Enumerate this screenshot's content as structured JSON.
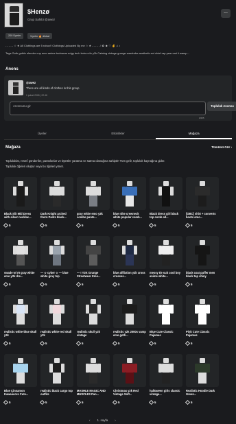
{
  "header": {
    "title": "$Henzø",
    "owner_label": "Grup Sahibi @awez",
    "more_label": "..."
  },
  "badges": [
    {
      "label": "200 Üyeler"
    },
    {
      "label": "Üyeler 🔥 dikkat"
    }
  ],
  "description": {
    "line1": "- - - - - ☆ ★ All Clothings are 5 robux!! Clothings Uploaded By me ☆ ★ - - - - - ! ✿ ☻ ♡ ✌ ♫ ♪",
    "line2": "Tags Goth gothic slender cnp emo anime tochwear edgy tech lmha e4x y2k Catalog vintage grunge wardrobe aesthetic ext chief rap year cari ii wamp..."
  },
  "shout": {
    "section_title": "Anons",
    "poster": "@awez",
    "message": "There are all kinds of clothes in this group",
    "date": "1 şubat 2026 | 22:46",
    "input_placeholder": "Anonsunu gir",
    "counter": "0/255",
    "post_button": "Topluluk Anonsu"
  },
  "tabs": [
    {
      "label": "Üyeler",
      "active": false
    },
    {
      "label": "Etkinlikler",
      "active": false
    },
    {
      "label": "Mağaza",
      "active": true
    }
  ],
  "store": {
    "title": "Mağaza",
    "see_all": "Tümünü Gör ›",
    "desc_line1": "Topluluklar, resmî gönderiler, pantolonlar ve tişörtler yaratma ve satma olanağına sahiptir! Tüm gelir, topluluk kaynağına gider.",
    "desc_line2": "Topluluk öğeleri oluştur veya bu öğeleri yönet."
  },
  "items": [
    {
      "name": "Black Slit Mid Dress with silver necklac...",
      "price": "5",
      "colors": {
        "torso": "#1a1a1a",
        "arms": "#dcdcdc",
        "legs": "#1a1a1a"
      }
    },
    {
      "name": "Dark Knight arched thorn Pants black...",
      "price": "5",
      "colors": {
        "torso": "#dcdcdc",
        "arms": "#dcdcdc",
        "legs": "#2a2a2a"
      }
    },
    {
      "name": "gray white emo y2k combo pants...",
      "price": "5",
      "colors": {
        "torso": "#dcdcdc",
        "arms": "#dcdcdc",
        "legs": "#7a7e85"
      }
    },
    {
      "name": "blue nike crewneck white popular comb...",
      "price": "5",
      "colors": {
        "torso": "#3a6fb8",
        "arms": "#3a6fb8",
        "legs": "#e8e8e8"
      }
    },
    {
      "name": "Black dress girl black top comb all...",
      "price": "5",
      "colors": {
        "torso": "#111111",
        "arms": "#dcdcdc",
        "legs": "#111111"
      }
    },
    {
      "name": "[OBC] shirt + converts boots emo...",
      "price": "5",
      "colors": {
        "torso": "#2b2b2b",
        "arms": "#2b2b2b",
        "legs": "#1c1c1c"
      }
    },
    {
      "name": "swade w/ r6 gray white emo y2k dre...",
      "price": "5",
      "colors": {
        "torso": "#e0e0e0",
        "arms": "#dcdcdc",
        "legs": "#555555"
      }
    },
    {
      "name": "— ☆ cyber ☆ — blue white gray top",
      "price": "5",
      "colors": {
        "torso": "#9aa3ad",
        "arms": "#dcdcdc",
        "legs": "#6e7680"
      }
    },
    {
      "name": "— ! Y2K Grunge Streetwear Emo...",
      "price": "5",
      "colors": {
        "torso": "#444444",
        "arms": "#444444",
        "legs": "#5c5c5c"
      }
    },
    {
      "name": "blue affliction y2k cross crosses...",
      "price": "5",
      "colors": {
        "torso": "#1f2a44",
        "arms": "#dcdcdc",
        "legs": "#2b3556"
      }
    },
    {
      "name": "messy tie suit cool boy anime white...",
      "price": "5",
      "colors": {
        "torso": "#eeeeee",
        "arms": "#eeeeee",
        "legs": "#222222"
      }
    },
    {
      "name": "black coat puffer men black top shiny",
      "price": "5",
      "colors": {
        "torso": "#151515",
        "arms": "#151515",
        "legs": "#151515"
      }
    },
    {
      "name": "realistic white-blue skull y2k",
      "price": "5",
      "colors": {
        "torso": "#d8e4f5",
        "arms": "#dcdcdc",
        "legs": "#dcdcdc"
      }
    },
    {
      "name": "realistic white-red skull y2k",
      "price": "5",
      "colors": {
        "torso": "#f0d8dc",
        "arms": "#dcdcdc",
        "legs": "#dcdcdc"
      }
    },
    {
      "name": "realistic skull y2k vintage",
      "price": "5",
      "colors": {
        "torso": "#2a2a2a",
        "arms": "#dcdcdc",
        "legs": "#dcdcdc"
      }
    },
    {
      "name": "realistic y2k 2000s vamp emo goth...",
      "price": "5",
      "colors": {
        "torso": "#1b1b1b",
        "arms": "#1b1b1b",
        "legs": "#dcdcdc"
      }
    },
    {
      "name": "Blue Cute Classic Pajamas",
      "price": "5",
      "colors": {
        "torso": "#ffffff",
        "arms": "#ffffff",
        "legs": "#ffffff"
      }
    },
    {
      "name": "Pink Cute Classic Pajamas",
      "price": "5",
      "colors": {
        "torso": "#ffffff",
        "arms": "#ffffff",
        "legs": "#ffffff"
      }
    },
    {
      "name": "Blue Cinnamon Kawaiicore Cute...",
      "price": "5",
      "colors": {
        "torso": "#a8d4ee",
        "arms": "#a8d4ee",
        "legs": "#dcdcdc"
      }
    },
    {
      "name": "realistic black cargo top outfits",
      "price": "5",
      "colors": {
        "torso": "#1e1e1e",
        "arms": "#dcdcdc",
        "legs": "#dcdcdc"
      }
    },
    {
      "name": "MASHLE MAGIC AND MUSCLES Pan...",
      "price": "5",
      "colors": {
        "torso": "#dcdcdc",
        "arms": "#dcdcdc",
        "legs": "#2a2a2a"
      }
    },
    {
      "name": "Christmas y2k Red Vintage Soft...",
      "price": "5",
      "colors": {
        "torso": "#8b1d24",
        "arms": "#8b1d24",
        "legs": "#5a1015"
      }
    },
    {
      "name": "halloween girls classic vintage...",
      "price": "5",
      "colors": {
        "torso": "#dcdcdc",
        "arms": "#dcdcdc",
        "legs": "#222222"
      }
    },
    {
      "name": "Realistic Hoodie Dark Green...",
      "price": "5",
      "colors": {
        "torso": "#2c3a2a",
        "arms": "#2c3a2a",
        "legs": "#dcdcdc"
      }
    }
  ],
  "pager": {
    "prev": "‹",
    "page": "1. sayfa",
    "next": "›"
  }
}
